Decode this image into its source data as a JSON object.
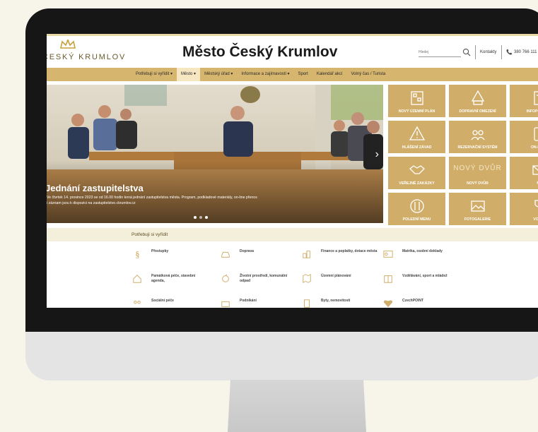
{
  "site": {
    "logo_text": "ČESKÝ KRUMLOV",
    "title": "Město Český Krumlov",
    "search_placeholder": "Hledej",
    "contacts": "Kontakty",
    "phone": "380 766 111"
  },
  "nav": {
    "items": [
      "Potřebuji si vyřídit ▾",
      "Město ▾",
      "Městský úřad ▾",
      "Informace a zajímavosti ▾",
      "Sport",
      "Kalendář akcí",
      "Volný čas / Turista"
    ]
  },
  "hero": {
    "title": "Jednání zastupitelstva",
    "subtitle": "Ve čtvrtek 14. prosince 2023 se od 16.00 hodin koná jednání zastupitelstva města. Program, podkladové materiály, on-line přenos i záznam jsou k dispozici na zastupitelstvo.ckrumlov.cz"
  },
  "tiles": [
    {
      "label": "NOVÝ ÚZEMNÍ PLÁN",
      "icon": "city-plan-icon"
    },
    {
      "label": "DOPRAVNÍ OMEZENÍ",
      "icon": "car-warning-icon"
    },
    {
      "label": "INFOPORTÁL",
      "icon": "document-icon"
    },
    {
      "label": "HLÁŠENÍ ZÁVAD",
      "icon": "warning-triangle-icon"
    },
    {
      "label": "REZERVAČNÍ SYSTÉM",
      "icon": "people-calendar-icon"
    },
    {
      "label": "ON-LINE",
      "icon": "tablet-icon"
    },
    {
      "label": "VEŘEJNÉ ZAKÁZKY",
      "icon": "handshake-icon"
    },
    {
      "label": "NOVÝ DVŮR",
      "icon": "novy-dvur-logo",
      "brand": "NOVÝ DVŮR"
    },
    {
      "label": "M",
      "icon": "envelope-icon"
    },
    {
      "label": "POLEDNÍ MENU",
      "icon": "plate-cutlery-icon"
    },
    {
      "label": "FOTOGALERIE",
      "icon": "image-icon"
    },
    {
      "label": "VOLN",
      "icon": "trophy-icon"
    }
  ],
  "potrebuji": {
    "title": "Potřebuji si vyřídit",
    "items": [
      {
        "label": "Přestupky",
        "icon": "paragraph-icon"
      },
      {
        "label": "Doprava",
        "icon": "car-icon"
      },
      {
        "label": "Finance a poplatky, dotace města",
        "icon": "coins-icon"
      },
      {
        "label": "Matrika, osobní doklady",
        "icon": "id-card-icon"
      },
      {
        "label": "Památková péče, stavební agenda,",
        "icon": "house-icon"
      },
      {
        "label": "Životní prostředí, komunální odpad",
        "icon": "recycle-icon"
      },
      {
        "label": "Územní plánování",
        "icon": "map-icon"
      },
      {
        "label": "Vzdělávání, sport a mládež",
        "icon": "book-icon"
      },
      {
        "label": "Sociální péče",
        "icon": "family-icon"
      },
      {
        "label": "Podnikání",
        "icon": "briefcase-icon"
      },
      {
        "label": "Byty, nemovitosti",
        "icon": "building-icon"
      },
      {
        "label": "CzechPOINT",
        "icon": "czechpoint-icon"
      }
    ]
  },
  "colors": {
    "accent": "#d0ad68",
    "nav": "#d6b56e",
    "active": "#f6e6c2"
  }
}
